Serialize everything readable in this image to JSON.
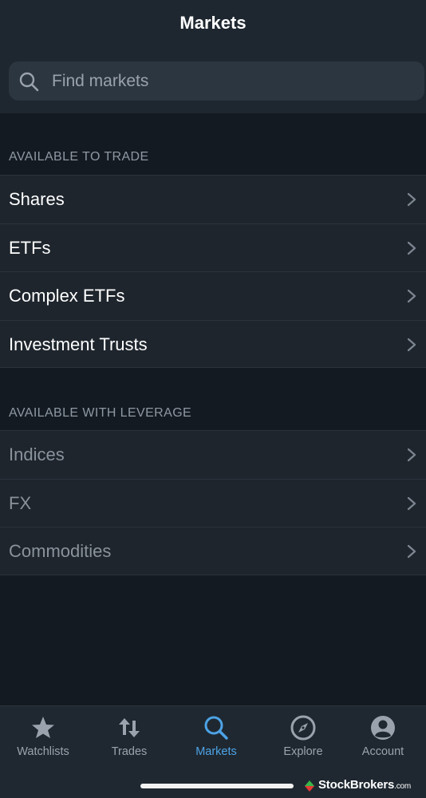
{
  "header": {
    "title": "Markets"
  },
  "search": {
    "placeholder": "Find markets"
  },
  "sections": [
    {
      "title": "AVAILABLE TO TRADE",
      "items": [
        "Shares",
        "ETFs",
        "Complex ETFs",
        "Investment Trusts"
      ]
    },
    {
      "title": "AVAILABLE WITH LEVERAGE",
      "items": [
        "Indices",
        "FX",
        "Commodities"
      ]
    }
  ],
  "tabs": [
    {
      "label": "Watchlists",
      "icon": "star-icon"
    },
    {
      "label": "Trades",
      "icon": "up-down-arrows-icon"
    },
    {
      "label": "Markets",
      "icon": "search-icon",
      "active": true
    },
    {
      "label": "Explore",
      "icon": "compass-icon"
    },
    {
      "label": "Account",
      "icon": "user-circle-icon"
    }
  ],
  "watermark": {
    "brand": "StockBrokers",
    "suffix": ".com"
  },
  "colors": {
    "background": "#141a21",
    "header": "#1e2730",
    "row": "#1e252d",
    "accent": "#4da3e6",
    "muted": "#8e98a3"
  }
}
